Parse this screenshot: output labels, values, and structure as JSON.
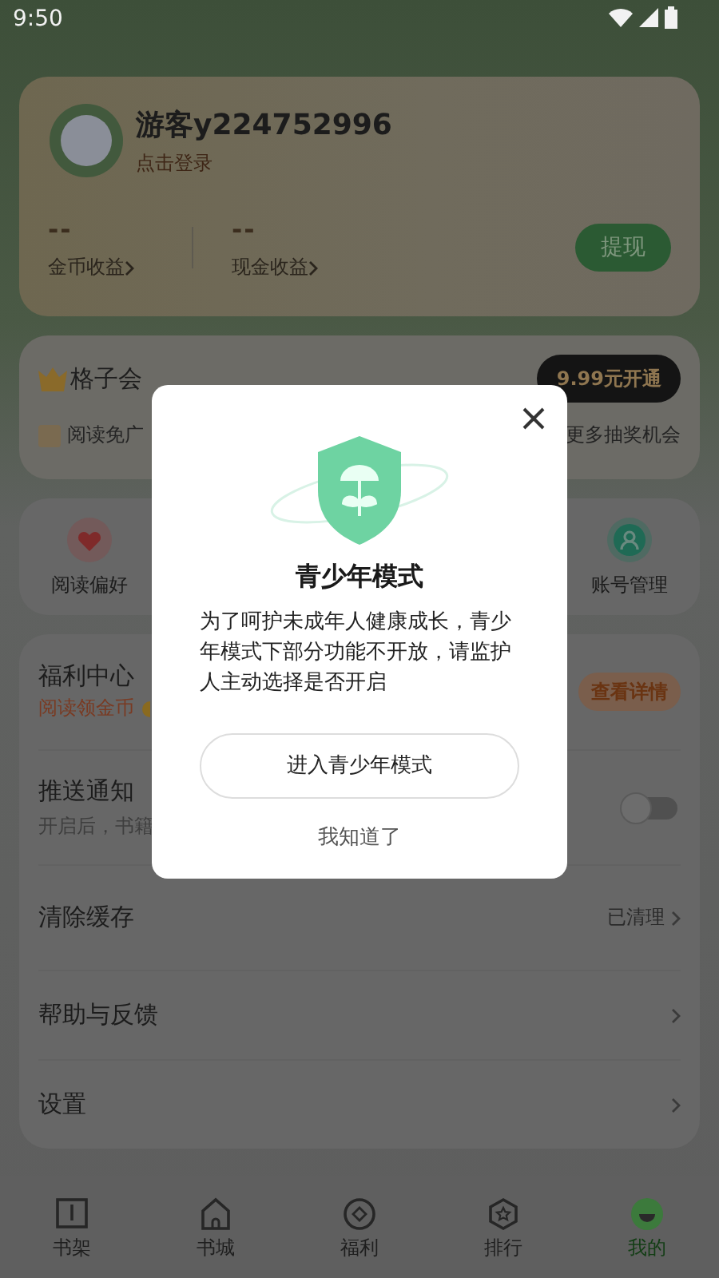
{
  "status_bar": {
    "time": "9:50"
  },
  "profile": {
    "name": "游客y224752996",
    "login": "点击登录",
    "stats": [
      {
        "value": "--",
        "label": "金币收益"
      },
      {
        "value": "--",
        "label": "现金收益"
      }
    ],
    "withdraw": "提现"
  },
  "vip": {
    "title": "格子会",
    "price_button": "9.99元开通",
    "perk_left": "阅读免广",
    "perk_right": "更多抽奖机会"
  },
  "shortcuts": [
    {
      "label": "阅读偏好",
      "kind": "heart"
    },
    {
      "label": "账号管理",
      "kind": "person"
    }
  ],
  "menu": [
    {
      "kind": "welfare",
      "title": "福利中心",
      "subtitle": "阅读领金币",
      "action": "查看详情"
    },
    {
      "kind": "toggle",
      "title": "推送通知",
      "subtitle": "开启后，书籍",
      "on": false
    },
    {
      "kind": "link",
      "title": "清除缓存",
      "value": "已清理"
    },
    {
      "kind": "link",
      "title": "帮助与反馈"
    },
    {
      "kind": "link",
      "title": "设置"
    }
  ],
  "tabs": [
    {
      "label": "书架",
      "kind": "book",
      "selected": false
    },
    {
      "label": "书城",
      "kind": "home",
      "selected": false
    },
    {
      "label": "福利",
      "kind": "coin",
      "selected": false
    },
    {
      "label": "排行",
      "kind": "rank",
      "selected": false
    },
    {
      "label": "我的",
      "kind": "me",
      "selected": true
    }
  ],
  "dialog": {
    "title": "青少年模式",
    "message": "为了呵护未成年人健康成长，青少年模式下部分功能不开放，请监护人主动选择是否开启",
    "primary": "进入青少年模式",
    "secondary": "我知道了"
  }
}
